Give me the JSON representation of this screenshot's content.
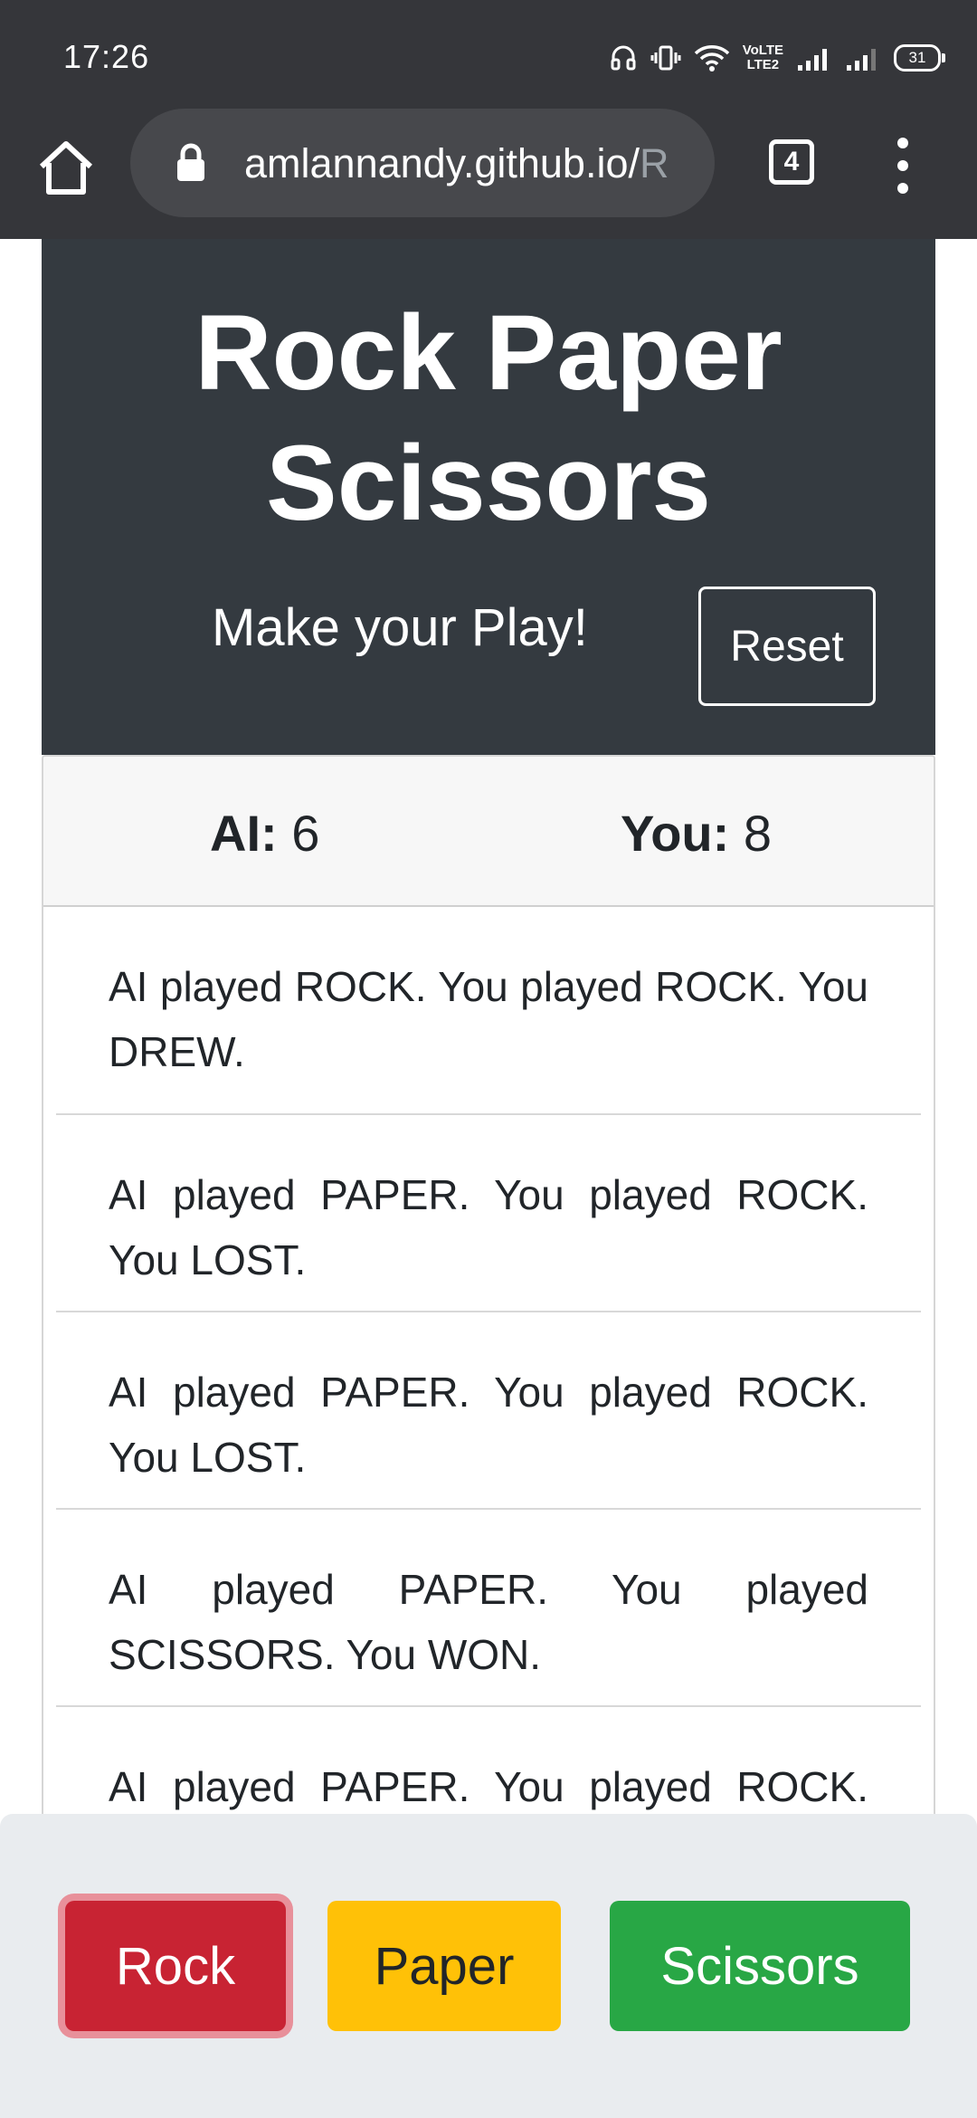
{
  "status_bar": {
    "time": "17:26",
    "volte_top": "VoLTE",
    "volte_bottom": "LTE2",
    "battery": "31",
    "icons": [
      "headphones-icon",
      "vibrate-icon",
      "wifi-icon",
      "volte-icon",
      "signal-icon",
      "signal-icon",
      "battery-icon"
    ]
  },
  "browser": {
    "url_visible": "amlannandy.github.io/",
    "url_faded": "R",
    "tab_count": "4",
    "icons": [
      "home-icon",
      "lock-icon",
      "tabs-icon",
      "more-vert-icon"
    ]
  },
  "header": {
    "title": "Rock Paper Scissors",
    "subtitle": "Make your Play!",
    "reset_label": "Reset",
    "background": "#343a40"
  },
  "score": {
    "ai_label": "AI:",
    "ai_value": "6",
    "you_label": "You:",
    "you_value": "8"
  },
  "history": [
    "AI played ROCK. You played ROCK. You DREW.",
    "AI played PAPER. You played ROCK. You LOST.",
    "AI played PAPER. You played ROCK. You LOST.",
    "AI played PAPER. You played SCISSORS. You WON.",
    "AI played PAPER. You played ROCK. You LOST."
  ],
  "actions": {
    "rock_label": "Rock",
    "paper_label": "Paper",
    "scissors_label": "Scissors",
    "colors": {
      "rock": "#c82333",
      "paper": "#ffc107",
      "scissors": "#28a745"
    }
  }
}
